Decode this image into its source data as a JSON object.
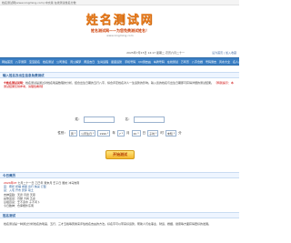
{
  "browser": {
    "url": "姓名测试网(www.xingming.com) 中文版 在线测试姓名分数"
  },
  "header": {
    "logo": "姓名测试网",
    "slogan": "姓名测试网——为您免费测试姓名！",
    "site_url": "www.xingming.com"
  },
  "infobar": {
    "date": "2025年7月15日 14:17 星期二  农历六月二十一",
    "links": "设为首页 | 加入收藏"
  },
  "nav": {
    "items": [
      "网站首页",
      "八字测算",
      "宝宝起名",
      "姓名测试",
      "公司测名",
      "周公解梦",
      "黄道吉日",
      "生肖运程",
      "星座运势",
      "手机号码",
      "QQ测吉凶",
      "车牌号码",
      "在线测试",
      "万年历",
      "八字合婚",
      "号码测吉",
      "风水大全",
      "名人八字"
    ]
  },
  "section1": {
    "title": "输入姓名及出生信息免费测试"
  },
  "intro": {
    "mark": "※",
    "label": "姓名测试说明：",
    "text": "姓名测试是通过对姓名笔画数理的分析，结合出生日期的五行八字，综合评定姓名对人一生运势的影响。输入您的姓名与出生日期即可获得详细的测试结果。",
    "note": "【特别提示：本测试结果仅供参考，请理性看待】"
  },
  "form": {
    "surname_label": "姓：",
    "given_label": "名：",
    "gender_label": "性别：",
    "gender_value": "男",
    "calendar_value": "公历生日",
    "year_value": "1990",
    "year_unit": "年",
    "month_value": "7",
    "month_unit": "月",
    "day_value": "20",
    "day_unit": "日",
    "hour_value": "子时",
    "hour_unit": "时",
    "minute_value": "未知",
    "minute_unit": "分",
    "submit": "开始测试"
  },
  "section2": {
    "title": "今日黄历"
  },
  "today": {
    "date_label": "2024年07",
    "line1": "七月二十一日  乙巳年 癸未月 壬子日  属蛇  冲马煞南",
    "line2": "宜：祭祀 祈福 求嗣 出行 纳采 订盟",
    "line3": "忌：入宅 开市 安葬 动土",
    "line4": "吉神宜趋：天德 月德 天恩",
    "line5": "凶煞宜忌：月破 大耗 五虚",
    "line6": "彭祖百忌：壬不汲水 子不问卜",
    "line7": "今日胎神：仓库栖外东南"
  },
  "section3": {
    "title": "姓名测试"
  },
  "desc": {
    "text": "姓名测试是一种通过分析姓名的笔画、五行、三才五格等因素来评估姓名吉凶的方法。好名字可以带来好运势，帮助人们在事业、财运、婚姻、健康等方面获得更好的发展。"
  }
}
